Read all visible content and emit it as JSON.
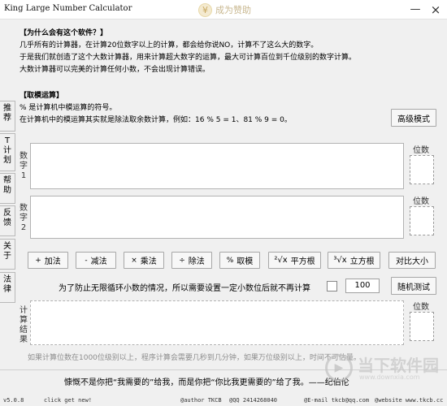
{
  "window": {
    "title": "King Large Number Calculator",
    "donate_icon": "¥",
    "donate_label": "成为赞助",
    "minimize": "—",
    "close": "×"
  },
  "intro": {
    "header": "【为什么会有这个软件？】",
    "lines": [
      "几乎所有的计算器，在计算20位数字以上的计算，都会给你说NO，计算不了这么大的数字。",
      "于是我们就创造了这个大数计算器，用来计算超大数字的运算，最大可计算百位到千位级别的数字计算。",
      "大数计算器可以完美的计算任何小数，不会出现计算错误。"
    ]
  },
  "modulo": {
    "header": "【取模运算】",
    "lines": [
      "% 是计算机中模运算的符号。",
      "在计算机中的模运算其实就是除法取余数计算，例如：16 % 5 = 1、81 % 9 = 0。"
    ]
  },
  "advanced_button": "高级模式",
  "sidebar": {
    "tabs": [
      [
        "推",
        "荐"
      ],
      [
        "T",
        "计",
        "划"
      ],
      [
        "帮",
        "助"
      ],
      [
        "反",
        "馈"
      ],
      [
        "关",
        "于"
      ],
      [
        "法",
        "律"
      ]
    ]
  },
  "number1": {
    "label": [
      "数",
      "字",
      "1"
    ],
    "value": "",
    "digits_label": "位数"
  },
  "number2": {
    "label": [
      "数",
      "字",
      "2"
    ],
    "value": "",
    "digits_label": "位数"
  },
  "result": {
    "label": [
      "计",
      "算",
      "结",
      "果"
    ],
    "value": "",
    "digits_label": "位数"
  },
  "operations": {
    "add": {
      "symbol": "+",
      "label": "加法"
    },
    "subtract": {
      "symbol": "-",
      "label": "减法"
    },
    "multiply": {
      "symbol": "×",
      "label": "乘法"
    },
    "divide": {
      "symbol": "÷",
      "label": "除法"
    },
    "modulo": {
      "symbol": "%",
      "label": "取模"
    },
    "sqrt": {
      "symbol": "²√x",
      "label": "平方根"
    },
    "cbrt": {
      "symbol": "³√x",
      "label": "立方根"
    },
    "compare": {
      "label": "对比大小"
    }
  },
  "limit": {
    "text": "为了防止无限循环小数的情况，所以需要设置一定小数位后就不再计算",
    "checked": false,
    "value": "100"
  },
  "random_button": "随机测试",
  "warning": "如果计算位数在1000位级别以上，程序计算会需要几秒到几分钟，如果万位级别以上，时间不可估量。",
  "quote": "慷慨不是你把“我需要的”给我，而是你把“你比我更需要的”给了我。——纪伯伦",
  "watermark": {
    "icon": "▶",
    "main": "当下软件园",
    "sub": "www.downxia.com"
  },
  "status": {
    "version": "v5.0.8",
    "click": "click get new!",
    "author": "@author TKCB",
    "qq": "@QQ 2414268040",
    "email": "@E-mail tkcb@qq.com",
    "website": "@website www.tkcb.cc"
  }
}
